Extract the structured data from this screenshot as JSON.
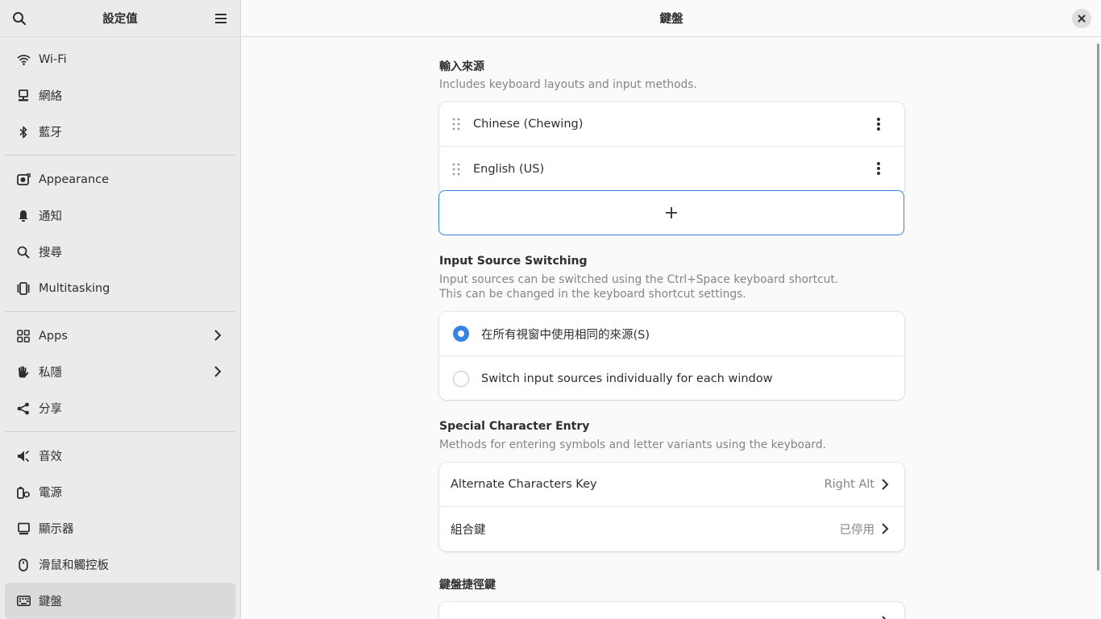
{
  "sidebar": {
    "title": "設定值",
    "items": [
      {
        "label": "Wi-Fi",
        "icon": "wifi-icon"
      },
      {
        "label": "網絡",
        "icon": "network-icon"
      },
      {
        "label": "藍牙",
        "icon": "bluetooth-icon"
      },
      {
        "label": "Appearance",
        "icon": "appearance-icon"
      },
      {
        "label": "通知",
        "icon": "bell-icon"
      },
      {
        "label": "搜尋",
        "icon": "search-icon"
      },
      {
        "label": "Multitasking",
        "icon": "multitasking-icon"
      },
      {
        "label": "Apps",
        "icon": "apps-icon"
      },
      {
        "label": "私隱",
        "icon": "hand-icon"
      },
      {
        "label": "分享",
        "icon": "share-icon"
      },
      {
        "label": "音效",
        "icon": "speaker-icon"
      },
      {
        "label": "電源",
        "icon": "power-icon"
      },
      {
        "label": "顯示器",
        "icon": "display-icon"
      },
      {
        "label": "滑鼠和觸控板",
        "icon": "mouse-icon"
      },
      {
        "label": "鍵盤",
        "icon": "keyboard-icon",
        "active": true
      }
    ]
  },
  "main": {
    "title": "鍵盤",
    "input_sources": {
      "title": "輸入來源",
      "description": "Includes keyboard layouts and input methods.",
      "sources": [
        "Chinese (Chewing)",
        "English (US)"
      ],
      "add_label": "+"
    },
    "switching": {
      "title": "Input Source Switching",
      "description_line1": "Input sources can be switched using the Ctrl+Space keyboard shortcut.",
      "description_line2": "This can be changed in the keyboard shortcut settings.",
      "options": [
        {
          "label": "在所有視窗中使用相同的來源(S)",
          "selected": true
        },
        {
          "label": "Switch input sources individually for each window",
          "selected": false
        }
      ]
    },
    "special": {
      "title": "Special Character Entry",
      "description": "Methods for entering symbols and letter variants using the keyboard.",
      "rows": [
        {
          "label": "Alternate Characters Key",
          "value": "Right Alt"
        },
        {
          "label": "組合鍵",
          "value": "已停用"
        }
      ]
    },
    "shortcuts": {
      "title": "鍵盤捷徑鍵"
    }
  },
  "colors": {
    "accent": "#3584e4",
    "sidebar_bg": "#ebebeb",
    "active_item": "#dadada"
  }
}
